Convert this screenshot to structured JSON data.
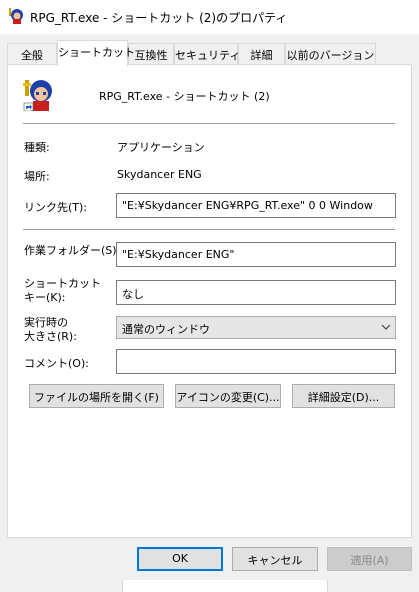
{
  "window": {
    "title": "RPG_RT.exe - ショートカット (2)のプロパティ",
    "icon": "rpg-character-app-icon"
  },
  "tabs": [
    {
      "label": "全般",
      "active": false
    },
    {
      "label": "ショートカット",
      "active": true
    },
    {
      "label": "互換性",
      "active": false
    },
    {
      "label": "セキュリティ",
      "active": false
    },
    {
      "label": "詳細",
      "active": false
    },
    {
      "label": "以前のバージョン",
      "active": false
    }
  ],
  "shortcut": {
    "name": "RPG_RT.exe - ショートカット (2)",
    "icon": "rpg-character-shortcut-icon"
  },
  "fields": {
    "type_label": "種類:",
    "type_value": "アプリケーション",
    "location_label": "場所:",
    "location_value": "Skydancer ENG",
    "target_label": "リンク先(T):",
    "target_value": "\"E:¥Skydancer ENG¥RPG_RT.exe\" 0 0 Window",
    "workdir_label": "作業フォルダー(S):",
    "workdir_value": "\"E:¥Skydancer ENG\"",
    "hotkey_label_line1": "ショートカット",
    "hotkey_label_line2": "キー(K):",
    "hotkey_value": "なし",
    "run_label_line1": "実行時の",
    "run_label_line2": "大きさ(R):",
    "run_value": "通常のウィンドウ",
    "comment_label": "コメント(O):",
    "comment_value": ""
  },
  "buttons": {
    "open_location": "ファイルの場所を開く(F)",
    "change_icon": "アイコンの変更(C)...",
    "advanced": "詳細設定(D)...",
    "ok": "OK",
    "cancel": "キャンセル",
    "apply": "適用(A)"
  },
  "colors": {
    "accent": "#0078d7",
    "dialog_bg": "#f0f0f0",
    "panel_bg": "#ffffff"
  }
}
